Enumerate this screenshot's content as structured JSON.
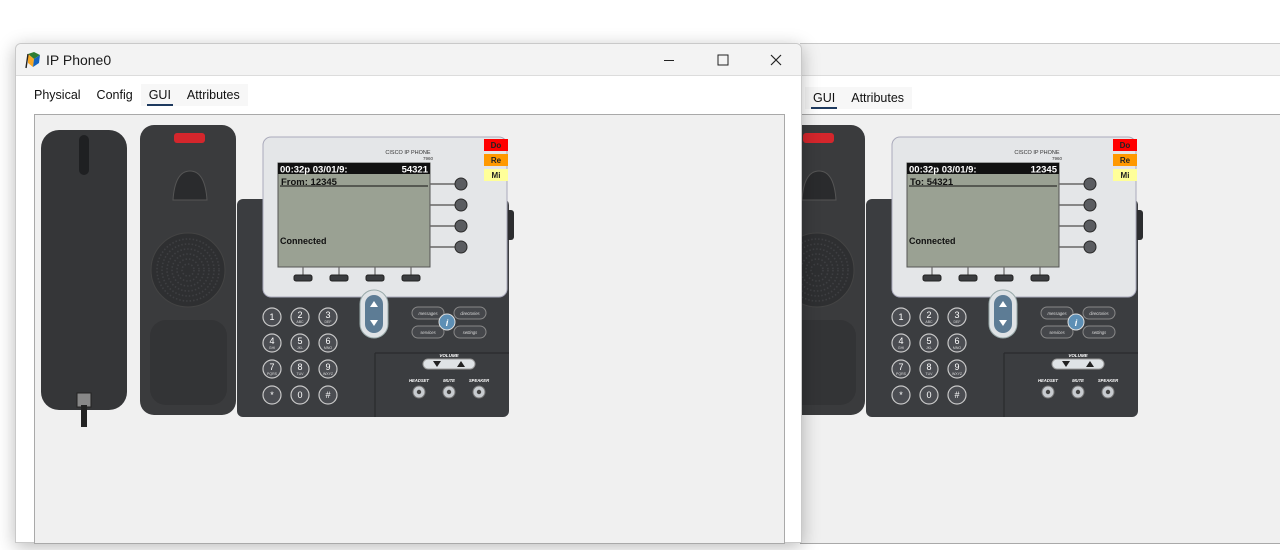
{
  "front_window": {
    "title": "IP Phone0",
    "tabs": [
      "Physical",
      "Config",
      "GUI",
      "Attributes"
    ],
    "selected_tab": "GUI",
    "phone": {
      "brand_line1": "CISCO IP PHONE",
      "brand_line2": "7960",
      "datetime": "00:32p 03/01/9:",
      "extension": "54321",
      "call_line": "From: 12345",
      "status": "Connected",
      "status_buttons": [
        "Do",
        "Re",
        "Mi"
      ]
    }
  },
  "back_window": {
    "tabs": [
      "GUI",
      "Attributes"
    ],
    "selected_tab": "GUI",
    "phone": {
      "brand_line1": "CISCO IP PHONE",
      "brand_line2": "7960",
      "datetime": "00:32p 03/01/9:",
      "extension": "12345",
      "call_line": "To: 54321",
      "status": "Connected",
      "status_buttons": [
        "Do",
        "Re",
        "Mi"
      ]
    }
  },
  "keypad": {
    "keys": [
      "1",
      "2",
      "3",
      "4",
      "5",
      "6",
      "7",
      "8",
      "9",
      "*",
      "0",
      "#"
    ],
    "subs": [
      "",
      "ABC",
      "DEF",
      "GHI",
      "JKL",
      "MNO",
      "PQRS",
      "TUV",
      "WXYZ",
      "",
      "",
      ""
    ]
  },
  "function_keys": {
    "messages": "messages",
    "directories": "directories",
    "services": "services",
    "settings": "settings",
    "info": "i",
    "volume": "VOLUME",
    "headset": "HEADSET",
    "mute": "MUTE",
    "speaker": "SPEAKER"
  },
  "colors": {
    "do_button": "#ff0000",
    "re_button": "#ff9900",
    "mi_button": "#ffff99",
    "lcd": "#9aa193",
    "phone_body": "#3b3d40"
  }
}
